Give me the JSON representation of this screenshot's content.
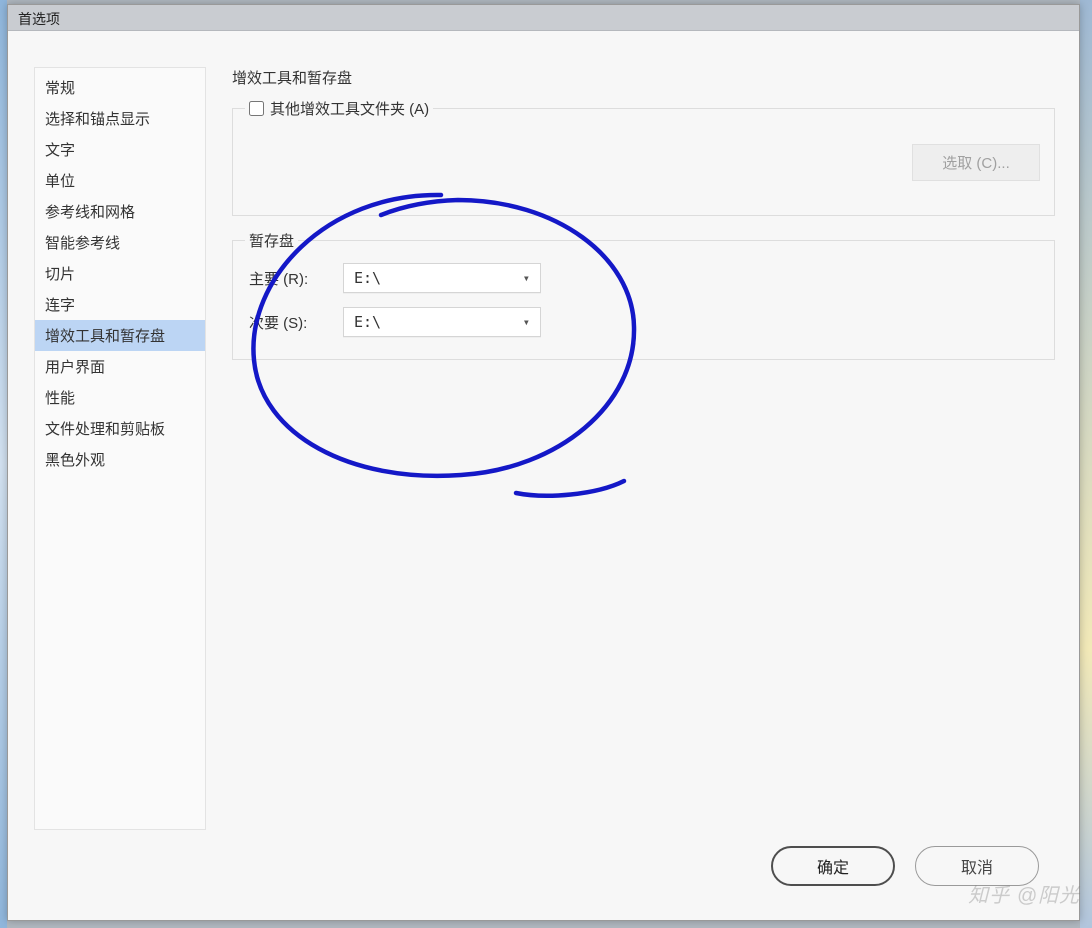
{
  "window": {
    "title": "首选项"
  },
  "sidebar": {
    "items": [
      {
        "label": "常规"
      },
      {
        "label": "选择和锚点显示"
      },
      {
        "label": "文字"
      },
      {
        "label": "单位"
      },
      {
        "label": "参考线和网格"
      },
      {
        "label": "智能参考线"
      },
      {
        "label": "切片"
      },
      {
        "label": "连字"
      },
      {
        "label": "增效工具和暂存盘"
      },
      {
        "label": "用户界面"
      },
      {
        "label": "性能"
      },
      {
        "label": "文件处理和剪贴板"
      },
      {
        "label": "黑色外观"
      }
    ],
    "selected_index": 8
  },
  "panel": {
    "title": "增效工具和暂存盘",
    "plugin_group": {
      "checkbox_label": "其他增效工具文件夹 (A)",
      "checkbox_checked": false,
      "choose_button": "选取 (C)..."
    },
    "scratch_group": {
      "title": "暂存盘",
      "primary_label": "主要 (R):",
      "primary_value": "E:\\",
      "secondary_label": "次要 (S):",
      "secondary_value": "E:\\"
    }
  },
  "footer": {
    "ok": "确定",
    "cancel": "取消"
  },
  "watermark": "知乎 @阳光"
}
